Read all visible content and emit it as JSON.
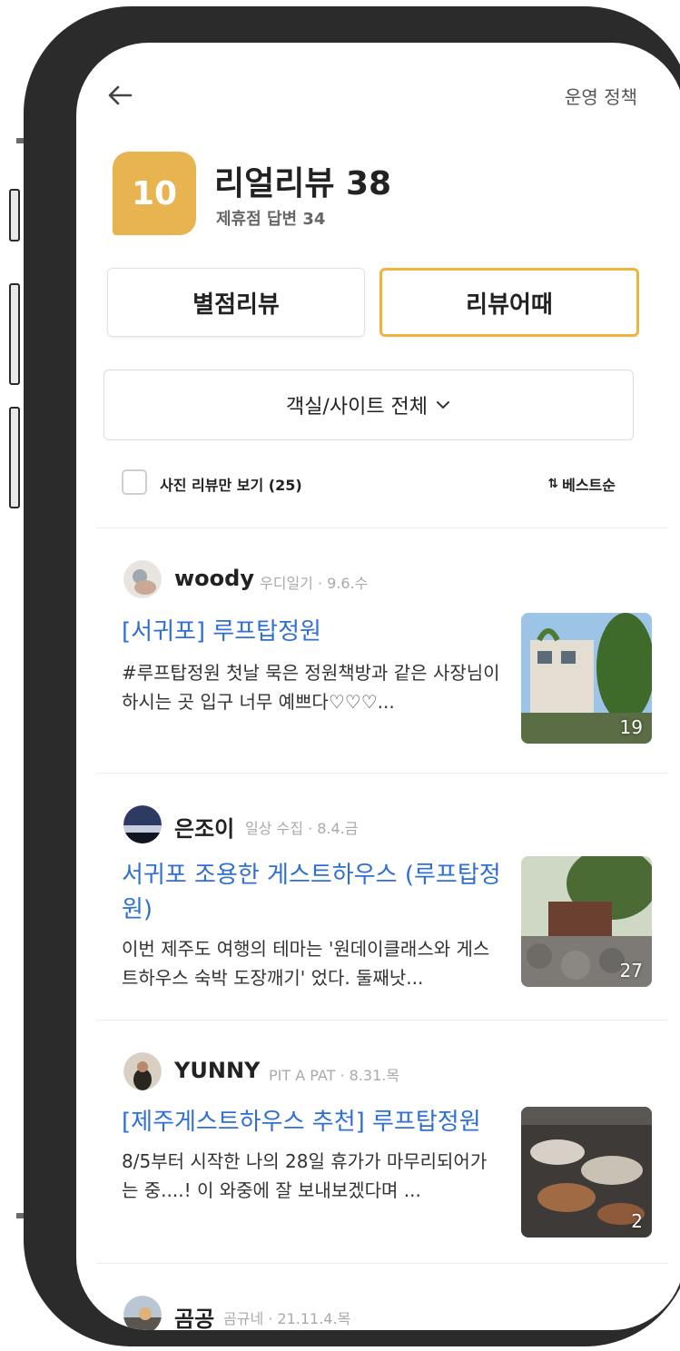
{
  "header": {
    "policy_label": "운영 정책"
  },
  "summary": {
    "badge_value": "10",
    "title": "리얼리뷰 38",
    "subtitle": "제휴점 답변 34"
  },
  "tabs": [
    {
      "label": "별점리뷰",
      "selected": false
    },
    {
      "label": "리뷰어때",
      "selected": true
    }
  ],
  "filter": {
    "room_filter_label": "객실/사이트 전체"
  },
  "options": {
    "photo_only_label": "사진 리뷰만 보기 (25)",
    "sort_icon": "⇅",
    "sort_label": "베스트순"
  },
  "colors": {
    "accent": "#f0b43c",
    "badge": "#e8b450",
    "link": "#2f6fd3"
  },
  "reviews": [
    {
      "author": "woody",
      "meta": "우디일기 · 9.6.수",
      "title": "[서귀포] 루프탑정원",
      "excerpt": "#루프탑정원 첫날 묵은 정원책방과 같은 사장님이 하시는 곳 입구 너무 예쁘다♡♡♡...",
      "photo_count": "19"
    },
    {
      "author": "은조이",
      "meta": "일상 수집 · 8.4.금",
      "title": "서귀포 조용한 게스트하우스 (루프탑정원)",
      "excerpt": "이번 제주도 여행의 테마는 '원데이클래스와 게스트하우스 숙박 도장깨기' 었다. 둘째낫...",
      "photo_count": "27"
    },
    {
      "author": "YUNNY",
      "meta": "PIT A PAT · 8.31.목",
      "title": "[제주게스트하우스 추천] 루프탑정원",
      "excerpt": "8/5부터 시작한 나의 28일 휴가가 마무리되어가는 중....! 이 와중에 잘 보내보겠다며 ...",
      "photo_count": "2"
    },
    {
      "author": "곰공",
      "meta": "곰규네 · 21.11.4.목"
    }
  ]
}
